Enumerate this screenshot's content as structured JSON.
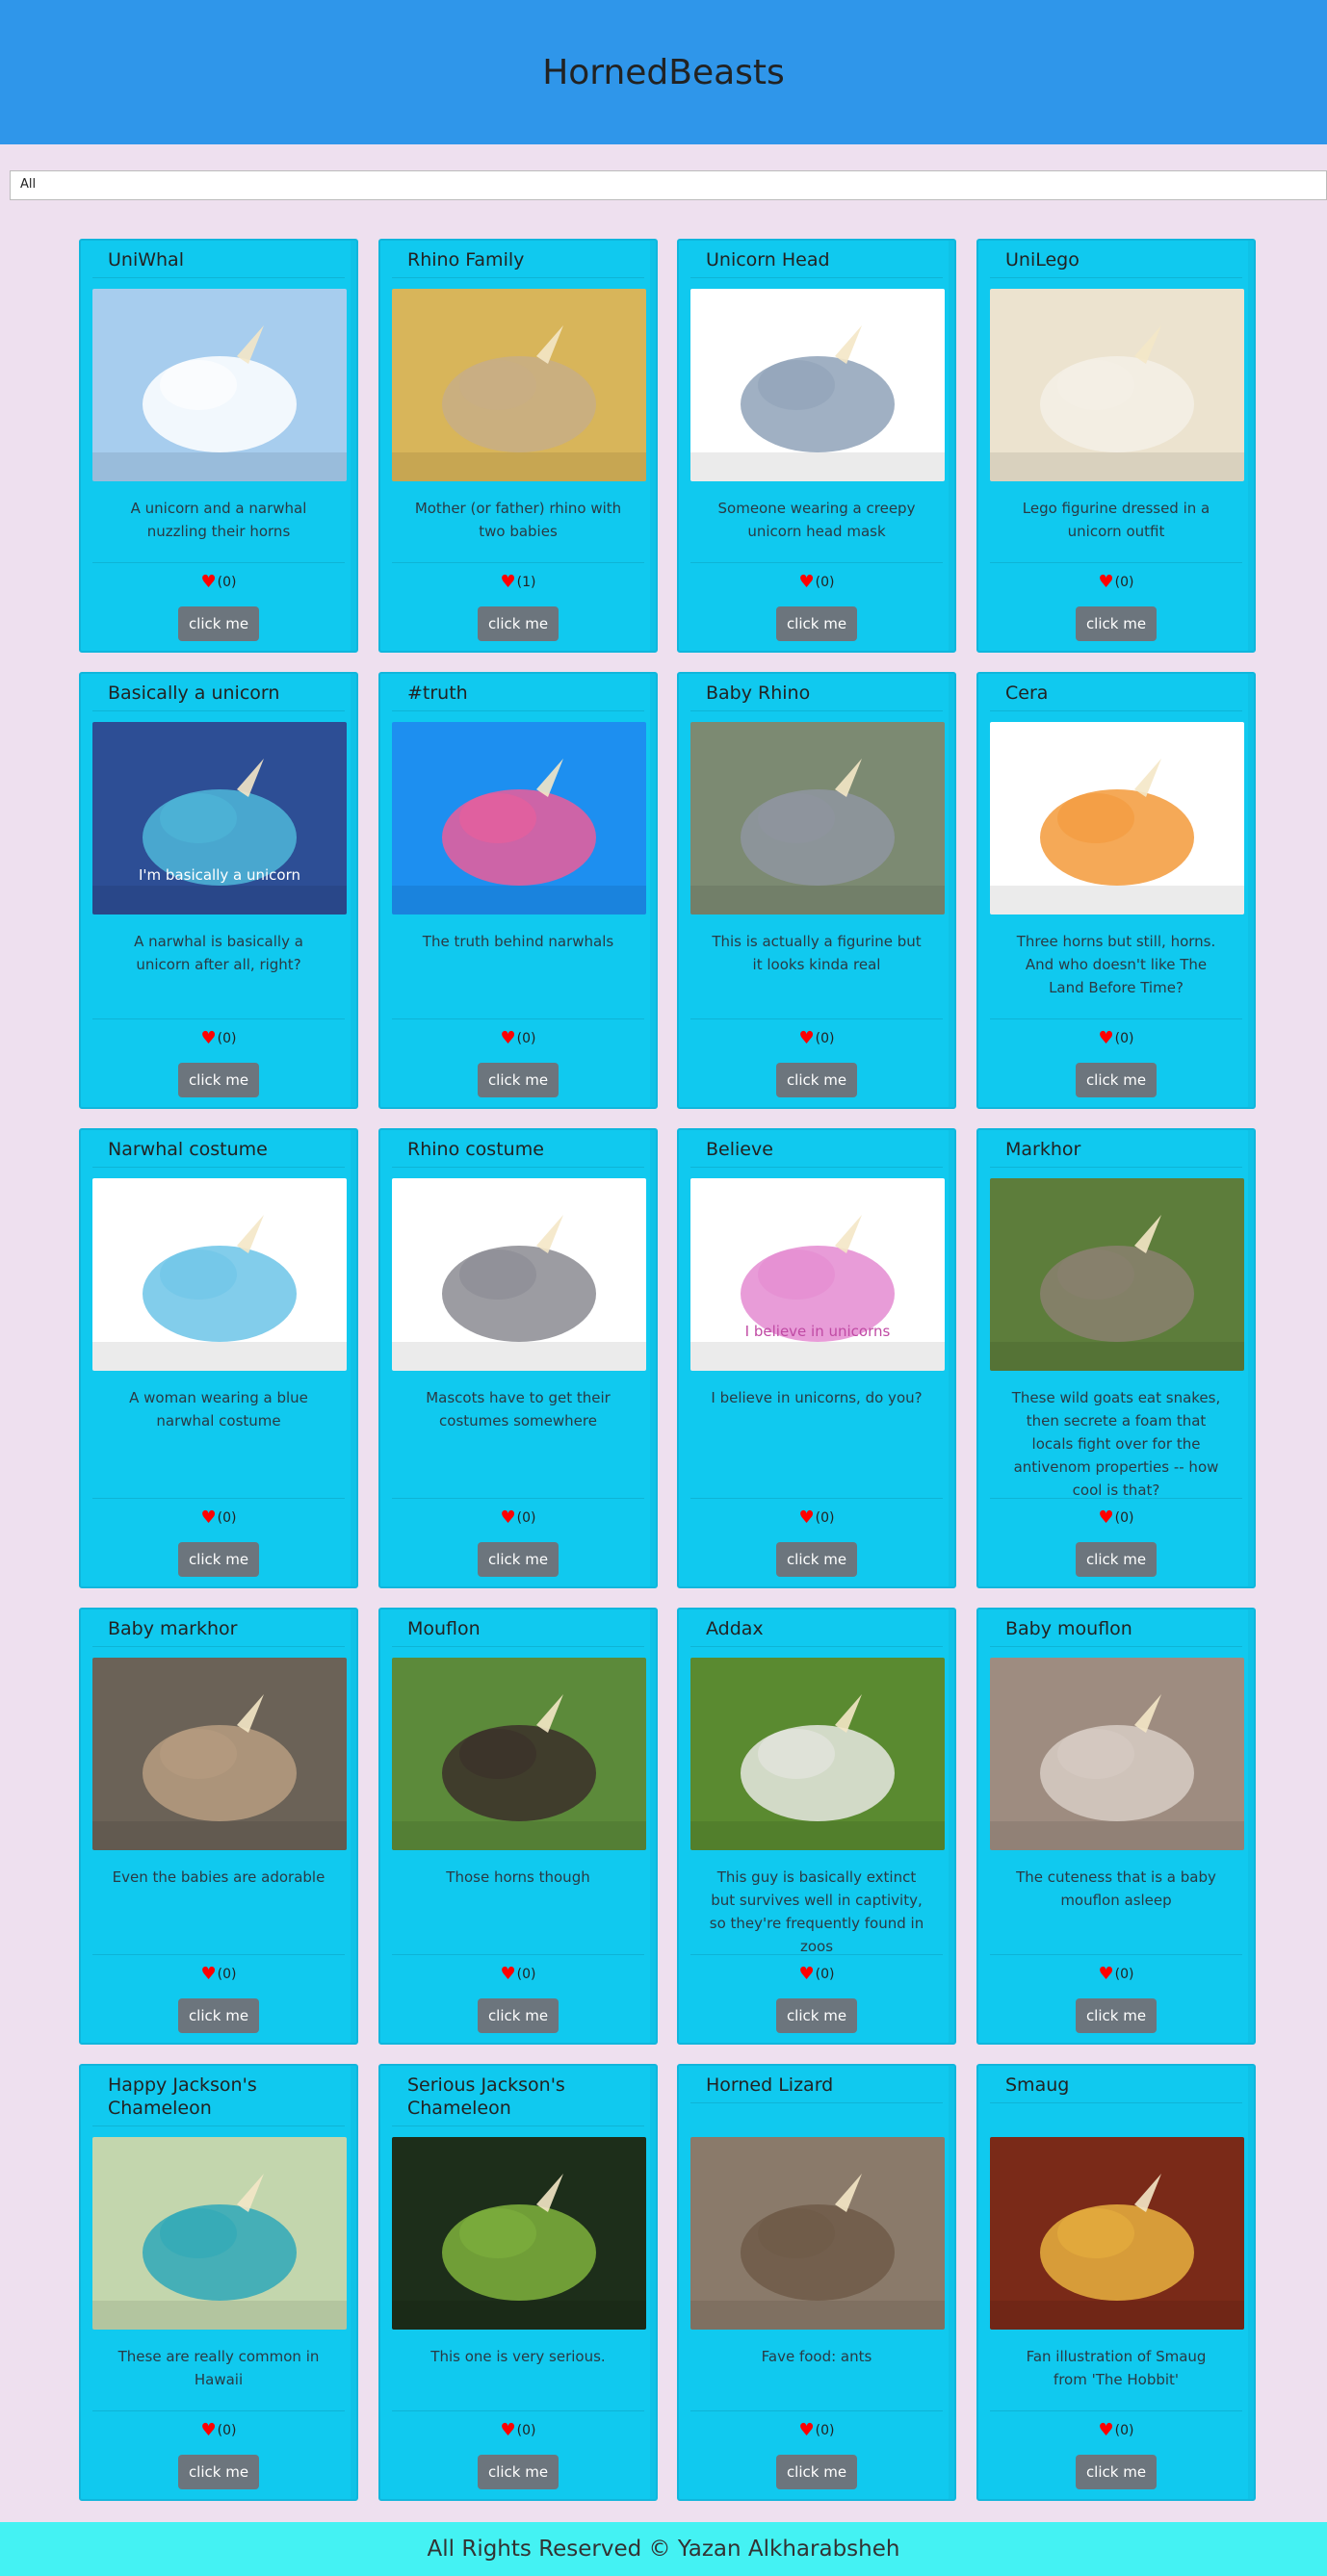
{
  "header": {
    "title": "HornedBeasts"
  },
  "filter": {
    "selected": "All"
  },
  "card_button_label": "click me",
  "cards": [
    {
      "title": "UniWhal",
      "description": "A unicorn and a narwhal nuzzling their horns",
      "votes": "(0)",
      "image": "unicorn-narwhal-illustration",
      "colors": [
        "#a7cdee",
        "#ffffff"
      ]
    },
    {
      "title": "Rhino Family",
      "description": "Mother (or father) rhino with two babies",
      "votes": "(1)",
      "image": "rhino-family-photo",
      "colors": [
        "#d8b55a",
        "#c8ae86"
      ]
    },
    {
      "title": "Unicorn Head",
      "description": "Someone wearing a creepy unicorn head mask",
      "votes": "(0)",
      "image": "unicorn-mask-photo",
      "colors": [
        "#ffffff",
        "#8fa2b8"
      ]
    },
    {
      "title": "UniLego",
      "description": "Lego figurine dressed in a unicorn outfit",
      "votes": "(0)",
      "image": "lego-unicorn-photo",
      "colors": [
        "#ece3cf",
        "#f5f0e6"
      ]
    },
    {
      "title": "Basically a unicorn",
      "description": "A narwhal is basically a unicorn after all, right?",
      "votes": "(0)",
      "image": "narwhal-cartoon",
      "colors": [
        "#2d4e95",
        "#4fb7d9"
      ],
      "caption": "I'm basically a unicorn"
    },
    {
      "title": "#truth",
      "description": "The truth behind narwhals",
      "votes": "(0)",
      "image": "narwhal-truth-illustration",
      "colors": [
        "#1d8ff0",
        "#ec5d9a"
      ]
    },
    {
      "title": "Baby Rhino",
      "description": "This is actually a figurine but it looks kinda real",
      "votes": "(0)",
      "image": "baby-rhino-photo",
      "colors": [
        "#7c8a72",
        "#8f95a0"
      ]
    },
    {
      "title": "Cera",
      "description": "Three horns but still, horns. And who doesn't like The Land Before Time?",
      "votes": "(0)",
      "image": "cera-cartoon",
      "colors": [
        "#ffffff",
        "#f39a3a"
      ]
    },
    {
      "title": "Narwhal costume",
      "description": "A woman wearing a blue narwhal costume",
      "votes": "(0)",
      "image": "narwhal-costume-photo",
      "colors": [
        "#ffffff",
        "#6cc4e8"
      ]
    },
    {
      "title": "Rhino costume",
      "description": "Mascots have to get their costumes somewhere",
      "votes": "(0)",
      "image": "rhino-mascot-photo",
      "colors": [
        "#ffffff",
        "#8b8b92"
      ]
    },
    {
      "title": "Believe",
      "description": "I believe in unicorns, do you?",
      "votes": "(0)",
      "image": "believe-unicorn-illustration",
      "colors": [
        "#ffffff",
        "#e48bd1"
      ],
      "caption": "I believe in unicorns"
    },
    {
      "title": "Markhor",
      "description": "These wild goats eat snakes, then secrete a foam that locals fight over for the antivenom properties -- how cool is that?",
      "votes": "(0)",
      "image": "markhor-photo",
      "colors": [
        "#5d7d3b",
        "#8a8070"
      ]
    },
    {
      "title": "Baby markhor",
      "description": "Even the babies are adorable",
      "votes": "(0)",
      "image": "baby-markhor-photo",
      "colors": [
        "#6b6257",
        "#b79d80"
      ]
    },
    {
      "title": "Mouflon",
      "description": "Those horns though",
      "votes": "(0)",
      "image": "mouflon-photo",
      "colors": [
        "#5c8a3a",
        "#3b2f2a"
      ]
    },
    {
      "title": "Addax",
      "description": "This guy is basically extinct but survives well in captivity, so they're frequently found in zoos",
      "votes": "(0)",
      "image": "addax-photo",
      "colors": [
        "#5a8a30",
        "#e8e8e2"
      ]
    },
    {
      "title": "Baby mouflon",
      "description": "The cuteness that is a baby mouflon asleep",
      "votes": "(0)",
      "image": "baby-mouflon-photo",
      "colors": [
        "#9e8c80",
        "#d7ccc4"
      ]
    },
    {
      "title": "Happy Jackson's Chameleon",
      "description": "These are really common in Hawaii",
      "votes": "(0)",
      "image": "chameleon-happy-photo",
      "colors": [
        "#c3d6ad",
        "#2fa8b8"
      ]
    },
    {
      "title": "Serious Jackson's Chameleon",
      "description": "This one is very serious.",
      "votes": "(0)",
      "image": "chameleon-serious-photo",
      "colors": [
        "#1d2e1a",
        "#7fb23d"
      ]
    },
    {
      "title": "Horned Lizard",
      "description": "Fave food: ants",
      "votes": "(0)",
      "image": "horned-lizard-photo",
      "colors": [
        "#8a7a6a",
        "#6e5a48"
      ]
    },
    {
      "title": "Smaug",
      "description": "Fan illustration of Smaug from 'The Hobbit'",
      "votes": "(0)",
      "image": "smaug-illustration",
      "colors": [
        "#7a2a18",
        "#e8b040"
      ]
    }
  ],
  "footer": {
    "text": "All Rights Reserved © Yazan Alkharabsheh"
  }
}
